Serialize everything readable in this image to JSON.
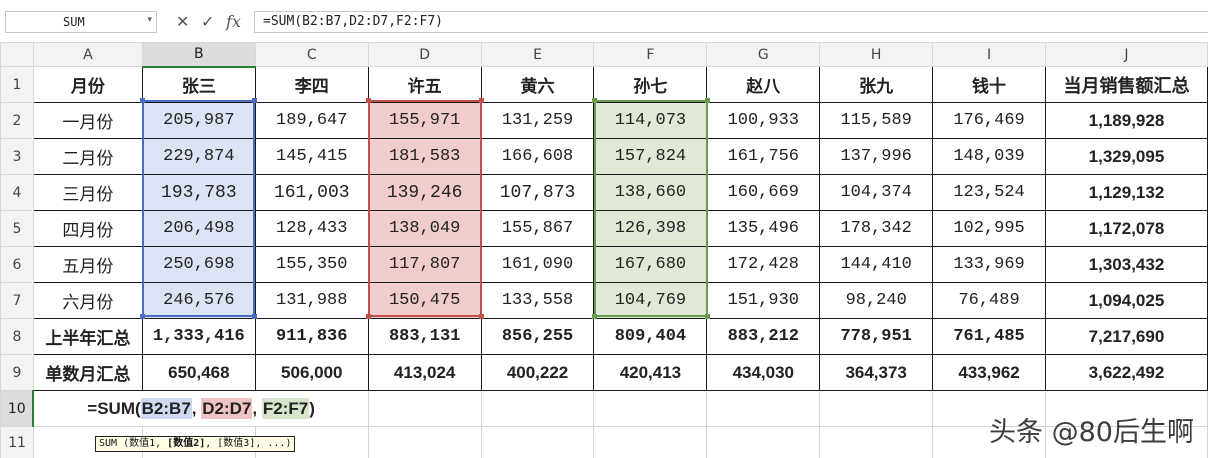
{
  "formula_bar": {
    "name_box": "SUM",
    "cancel_icon": "✕",
    "enter_icon": "✓",
    "fx_label": "fx",
    "formula": "=SUM(B2:B7,D2:D7,F2:F7)"
  },
  "columns": [
    "A",
    "B",
    "C",
    "D",
    "E",
    "F",
    "G",
    "H",
    "I",
    "J"
  ],
  "rows": [
    "1",
    "2",
    "3",
    "4",
    "5",
    "6",
    "7",
    "8",
    "9",
    "10",
    "11"
  ],
  "header_row": [
    "月份",
    "张三",
    "李四",
    "许五",
    "黄六",
    "孙七",
    "赵八",
    "张九",
    "钱十",
    "当月销售额汇总"
  ],
  "data_rows": [
    {
      "month": "一月份",
      "values": [
        "205,987",
        "189,647",
        "155,971",
        "131,259",
        "114,073",
        "100,933",
        "115,589",
        "176,469"
      ],
      "total": "1,189,928"
    },
    {
      "month": "二月份",
      "values": [
        "229,874",
        "145,415",
        "181,583",
        "166,608",
        "157,824",
        "161,756",
        "137,996",
        "148,039"
      ],
      "total": "1,329,095"
    },
    {
      "month": "三月份",
      "values": [
        "193,783",
        "161,003",
        "139,246",
        "107,873",
        "138,660",
        "160,669",
        "104,374",
        "123,524"
      ],
      "total": "1,129,132"
    },
    {
      "month": "四月份",
      "values": [
        "206,498",
        "128,433",
        "138,049",
        "155,867",
        "126,398",
        "135,496",
        "178,342",
        "102,995"
      ],
      "total": "1,172,078"
    },
    {
      "month": "五月份",
      "values": [
        "250,698",
        "155,350",
        "117,807",
        "161,090",
        "167,680",
        "172,428",
        "144,410",
        "133,969"
      ],
      "total": "1,303,432"
    },
    {
      "month": "六月份",
      "values": [
        "246,576",
        "131,988",
        "150,475",
        "133,558",
        "104,769",
        "151,930",
        "98,240",
        "76,489"
      ],
      "total": "1,094,025"
    }
  ],
  "half_year_row": {
    "label": "上半年汇总",
    "values": [
      "1,333,416",
      "911,836",
      "883,131",
      "856,255",
      "809,404",
      "883,212",
      "778,951",
      "761,485"
    ],
    "total": "7,217,690"
  },
  "odd_month_row": {
    "label": "单数月汇总",
    "values": [
      "650,468",
      "506,000",
      "413,024",
      "400,222",
      "420,413",
      "434,030",
      "364,373",
      "433,962"
    ],
    "total": "3,622,492"
  },
  "edit_cell": {
    "prefix": "=SUM(",
    "ref1": "B2:B7",
    "sep1": ",",
    "ref2": "D2:D7",
    "sep2": ",",
    "ref3": "F2:F7",
    "suffix": ")"
  },
  "tooltip": {
    "prefix": "SUM (数值1, ",
    "bold": "[数值2]",
    "suffix": ", [数值3], ...)"
  },
  "watermark": "头条 @80后生啊",
  "colors": {
    "accent": "#2e7d32",
    "ref_b": "#4a6cc4",
    "ref_d": "#c0504d",
    "ref_f": "#6a9a4f"
  }
}
